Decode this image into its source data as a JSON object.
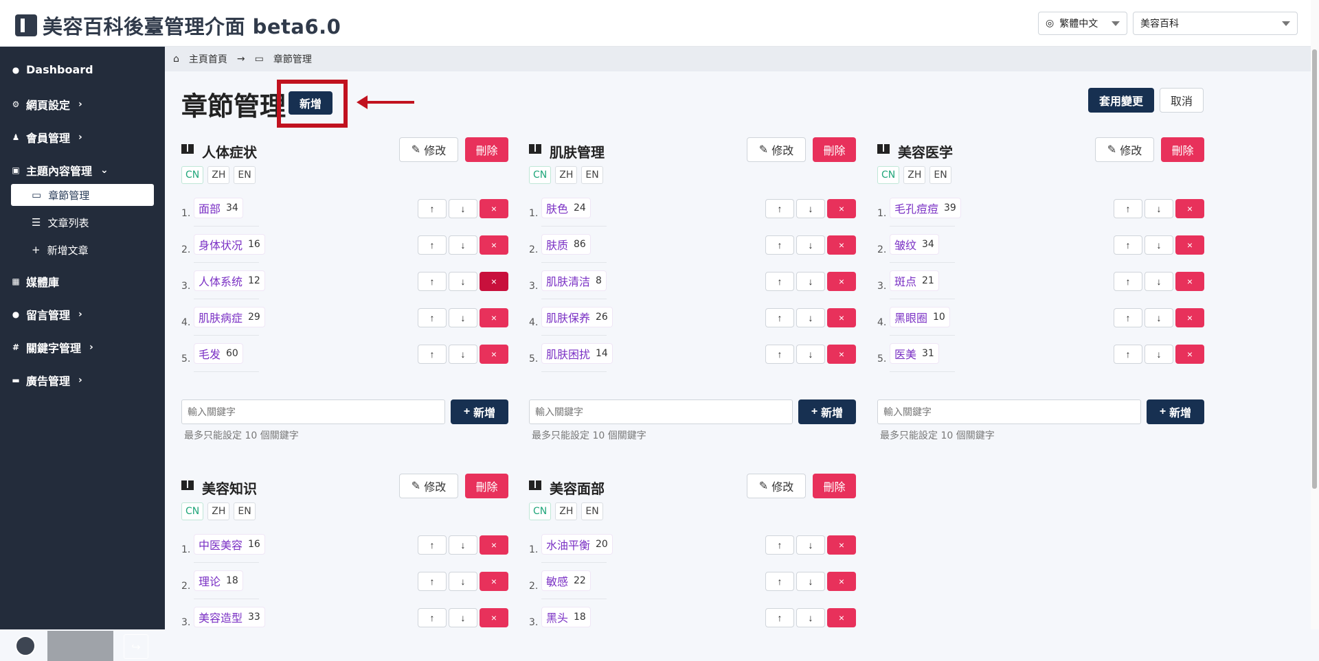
{
  "header": {
    "title": "美容百科後臺管理介面 beta6.0",
    "language": "繁體中文",
    "site": "美容百科"
  },
  "sidebar": {
    "items": [
      {
        "label": "Dashboard",
        "icon": "dashboard-icon"
      },
      {
        "label": "網頁設定",
        "icon": "gear-icon"
      },
      {
        "label": "會員管理",
        "icon": "users-icon"
      },
      {
        "label": "主題內容管理",
        "icon": "folder-icon"
      },
      {
        "label": "媒體庫",
        "icon": "media-icon"
      },
      {
        "label": "留言管理",
        "icon": "chat-icon"
      },
      {
        "label": "關鍵字管理",
        "icon": "hash-icon"
      },
      {
        "label": "廣告管理",
        "icon": "ad-icon"
      }
    ],
    "subitems": [
      {
        "label": "章節管理"
      },
      {
        "label": "文章列表"
      },
      {
        "label": "新增文章"
      }
    ]
  },
  "breadcrumb": {
    "home": "主頁首頁",
    "current": "章節管理"
  },
  "page": {
    "title": "章節管理",
    "add": "新增",
    "apply": "套用變更",
    "cancel": "取消"
  },
  "common": {
    "edit": "修改",
    "delete": "刪除",
    "langs": [
      "CN",
      "ZH",
      "EN"
    ],
    "add": "新增",
    "placeholder": "輸入關鍵字",
    "hint": "最多只能設定 10 個關鍵字"
  },
  "panels": [
    {
      "title": "人体症状",
      "items": [
        {
          "n": "1.",
          "name": "面部",
          "count": "34"
        },
        {
          "n": "2.",
          "name": "身体状况",
          "count": "16"
        },
        {
          "n": "3.",
          "name": "人体系统",
          "count": "12"
        },
        {
          "n": "4.",
          "name": "肌肤病症",
          "count": "29"
        },
        {
          "n": "5.",
          "name": "毛发",
          "count": "60"
        }
      ]
    },
    {
      "title": "肌肤管理",
      "items": [
        {
          "n": "1.",
          "name": "肤色",
          "count": "24"
        },
        {
          "n": "2.",
          "name": "肤质",
          "count": "86"
        },
        {
          "n": "3.",
          "name": "肌肤清洁",
          "count": "8"
        },
        {
          "n": "4.",
          "name": "肌肤保养",
          "count": "26"
        },
        {
          "n": "5.",
          "name": "肌肤困扰",
          "count": "14"
        }
      ]
    },
    {
      "title": "美容医学",
      "items": [
        {
          "n": "1.",
          "name": "毛孔痘痘",
          "count": "39"
        },
        {
          "n": "2.",
          "name": "皱纹",
          "count": "34"
        },
        {
          "n": "3.",
          "name": "斑点",
          "count": "21"
        },
        {
          "n": "4.",
          "name": "黑眼圈",
          "count": "10"
        },
        {
          "n": "5.",
          "name": "医美",
          "count": "31"
        }
      ]
    },
    {
      "title": "美容知识",
      "items": [
        {
          "n": "1.",
          "name": "中医美容",
          "count": "16"
        },
        {
          "n": "2.",
          "name": "理论",
          "count": "18"
        },
        {
          "n": "3.",
          "name": "美容造型",
          "count": "33"
        }
      ]
    },
    {
      "title": "美容面部",
      "items": [
        {
          "n": "1.",
          "name": "水油平衡",
          "count": "20"
        },
        {
          "n": "2.",
          "name": "敏感",
          "count": "22"
        },
        {
          "n": "3.",
          "name": "黑头",
          "count": "18"
        }
      ]
    }
  ]
}
